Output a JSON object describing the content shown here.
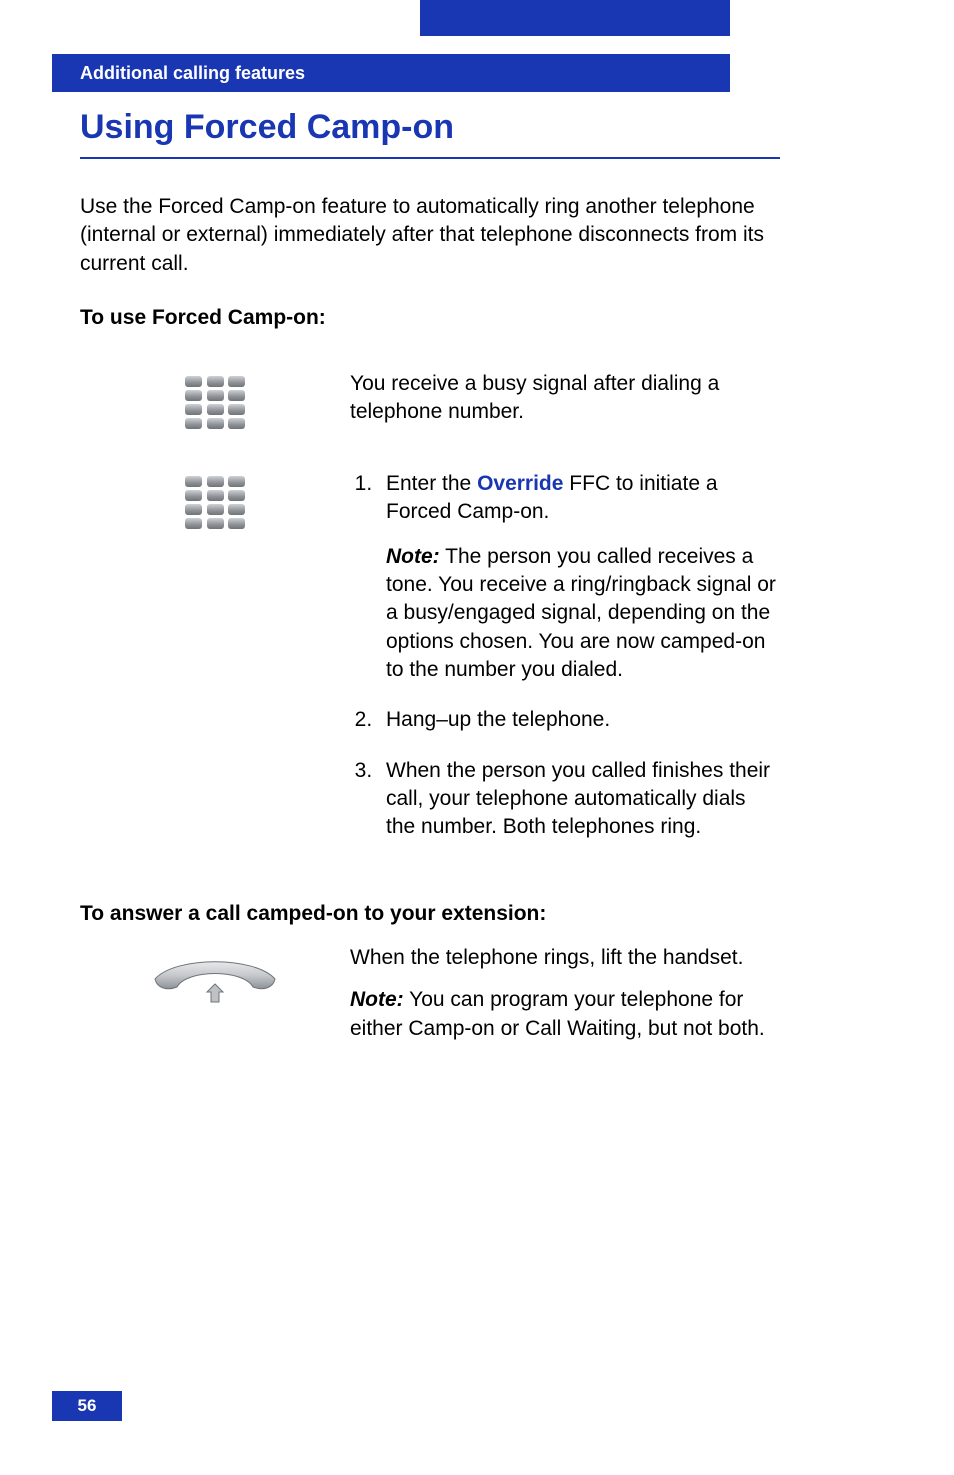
{
  "header": {
    "section": "Additional calling features"
  },
  "title": "Using Forced Camp-on",
  "intro": "Use the Forced Camp-on feature to automatically ring another telephone (internal or external) immediately after that telephone disconnects from its current call.",
  "sub1": "To use Forced Camp-on:",
  "row1_text": "You receive a busy signal after dialing a telephone number.",
  "step1_prefix": "Enter the ",
  "step1_ffc": "Override",
  "step1_suffix": " FFC to initiate a Forced Camp-on.",
  "step1_note_label": "Note:",
  "step1_note_body": " The person you called receives a tone. You receive a ring/ringback signal or a busy/engaged signal, depending on the options chosen. You are now camped-on to the number you dialed.",
  "step2": "Hang–up the telephone.",
  "step3": "When the person you called finishes their call, your telephone automatically dials the number. Both telephones ring.",
  "sub2": "To answer a call camped-on to your extension:",
  "answer_text": "When the telephone rings, lift the handset.",
  "answer_note_label": "Note:",
  "answer_note_body": " You can program your telephone for either Camp-on or Call Waiting, but not both.",
  "page_number": "56"
}
